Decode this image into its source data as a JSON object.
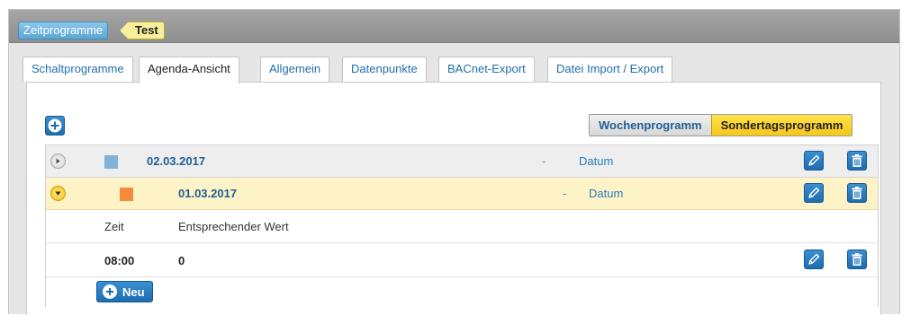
{
  "breadcrumb": {
    "root": "Zeitprogramme",
    "current": "Test"
  },
  "tabs": [
    {
      "label": "Schaltprogramme"
    },
    {
      "label": "Agenda-Ansicht",
      "active": true
    },
    {
      "label": "Allgemein"
    },
    {
      "label": "Datenpunkte"
    },
    {
      "label": "BACnet-Export"
    },
    {
      "label": "Datei Import / Export"
    }
  ],
  "mode_toggle": {
    "week": "Wochenprogramm",
    "special": "Sondertagsprogramm",
    "selected": "special"
  },
  "entries": [
    {
      "date": "02.03.2017",
      "separator": "-",
      "type": "Datum",
      "color": "#7fb3dc",
      "expanded": false
    },
    {
      "date": "01.03.2017",
      "separator": "-",
      "type": "Datum",
      "color": "#f28c3a",
      "expanded": true
    }
  ],
  "detail_table": {
    "headers": {
      "time": "Zeit",
      "value": "Entsprechender Wert"
    },
    "rows": [
      {
        "time": "08:00",
        "value": "0"
      }
    ]
  },
  "new_button": {
    "label": "Neu"
  },
  "colors": {
    "accent_blue": "#1d6db0",
    "highlight_row": "#fdf3c6",
    "toggle_active": "#f7c71a"
  }
}
